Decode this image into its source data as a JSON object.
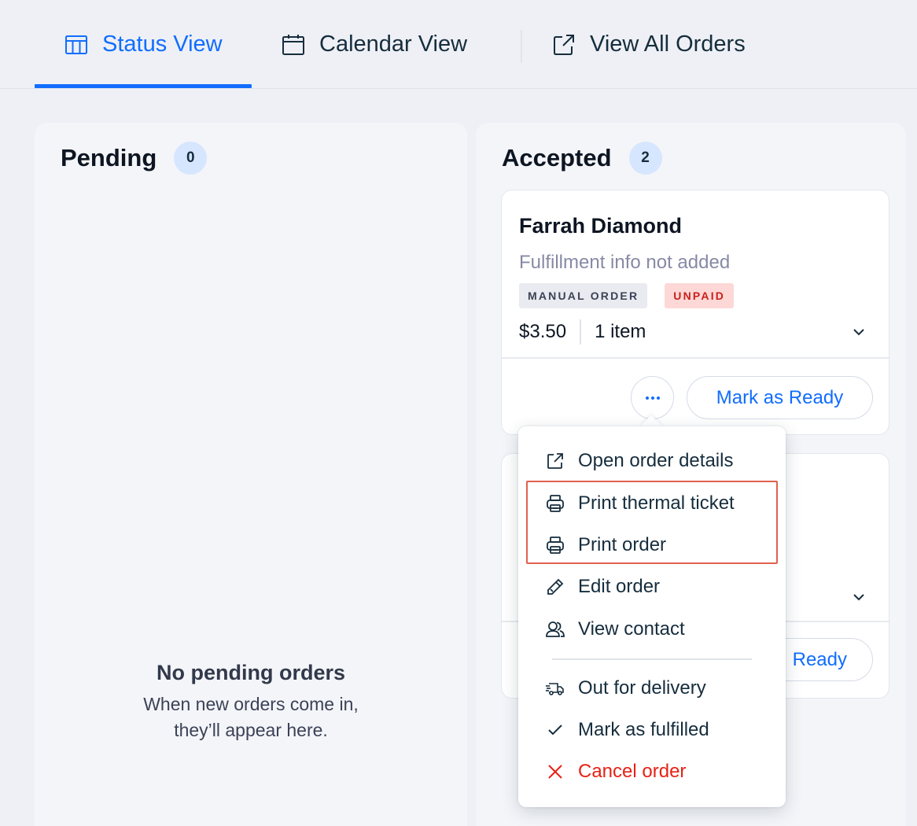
{
  "tabs": [
    {
      "label": "Status View",
      "icon": "table-icon",
      "active": true
    },
    {
      "label": "Calendar View",
      "icon": "calendar-icon",
      "active": false
    },
    {
      "label": "View All Orders",
      "icon": "external-link-icon",
      "active": false
    }
  ],
  "columns": {
    "pending": {
      "title": "Pending",
      "count": "0",
      "empty_title": "No pending orders",
      "empty_line1": "When new orders come in,",
      "empty_line2": "they’ll appear here."
    },
    "accepted": {
      "title": "Accepted",
      "count": "2",
      "order1": {
        "customer": "Farrah Diamond",
        "fulfillment": "Fulfillment info not added",
        "tag_manual": "MANUAL ORDER",
        "tag_unpaid": "UNPAID",
        "price": "$3.50",
        "items": "1 item",
        "ready_label": "Mark as Ready"
      },
      "order2": {
        "ready_label": "Ready"
      }
    }
  },
  "menu": {
    "open_details": "Open order details",
    "print_thermal": "Print thermal ticket",
    "print_order": "Print order",
    "edit_order": "Edit order",
    "view_contact": "View contact",
    "out_for_delivery": "Out for delivery",
    "mark_fulfilled": "Mark as fulfilled",
    "cancel_order": "Cancel order"
  },
  "colors": {
    "accent": "#116dff",
    "danger": "#e62214",
    "highlight": "#e0614f"
  }
}
